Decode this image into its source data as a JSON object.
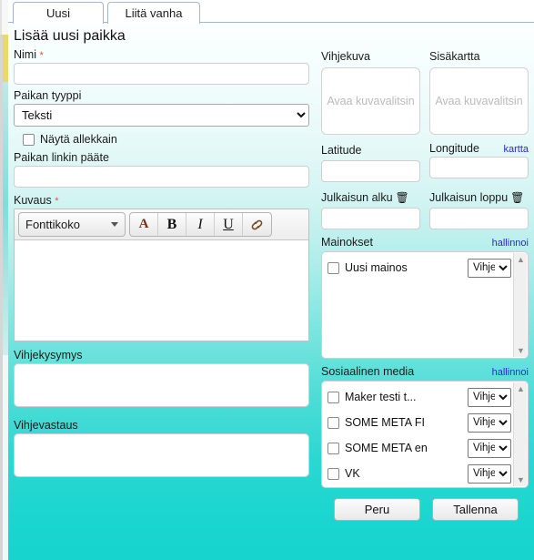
{
  "tabs": [
    {
      "label": "Uusi",
      "active": true
    },
    {
      "label": "Liitä vanha",
      "active": false
    }
  ],
  "page": {
    "title": "Lisää uusi paikka"
  },
  "left": {
    "name": {
      "label": "Nimi",
      "required": "*",
      "value": "",
      "placeholder": ""
    },
    "type": {
      "label": "Paikan tyyppi",
      "selected": "Teksti"
    },
    "show_stacked": {
      "label": "Näytä allekkain",
      "checked": false
    },
    "link_suffix": {
      "label": "Paikan linkin pääte",
      "value": "",
      "placeholder": ""
    },
    "description": {
      "label": "Kuvaus",
      "required": "*",
      "fontsize_label": "Fonttikoko",
      "tools": [
        {
          "name": "font-color-icon",
          "glyph": "A"
        },
        {
          "name": "bold-icon",
          "glyph": "B"
        },
        {
          "name": "italic-icon",
          "glyph": "I"
        },
        {
          "name": "underline-icon",
          "glyph": "U"
        },
        {
          "name": "link-icon",
          "glyph": ""
        }
      ],
      "value": ""
    },
    "hint_question": {
      "label": "Vihjekysymys",
      "value": ""
    },
    "hint_answer": {
      "label": "Vihjevastaus",
      "value": ""
    }
  },
  "right": {
    "hint_image": {
      "label": "Vihjekuva",
      "placeholder": "Avaa kuvavalitsin"
    },
    "indoor_map": {
      "label": "Sisäkartta",
      "placeholder": "Avaa kuvavalitsin"
    },
    "latitude": {
      "label": "Latitude",
      "value": ""
    },
    "longitude": {
      "label": "Longitude",
      "value": ""
    },
    "map_link": "kartta",
    "publish_start": {
      "label": "Julkaisun alku",
      "value": "",
      "trash": "🗑"
    },
    "publish_end": {
      "label": "Julkaisun loppu",
      "value": "",
      "trash": "🗑"
    },
    "ads": {
      "label": "Mainokset",
      "manage_link": "hallinnoi",
      "items": [
        {
          "name": "Uusi mainos",
          "checked": false,
          "select": "Vihje"
        }
      ]
    },
    "social": {
      "label": "Sosiaalinen media",
      "manage_link": "hallinnoi",
      "items": [
        {
          "name": "Maker testi t...",
          "checked": false,
          "select": "Vihje"
        },
        {
          "name": "SOME META FI",
          "checked": false,
          "select": "Vihje"
        },
        {
          "name": "SOME META en",
          "checked": false,
          "select": "Vihje"
        },
        {
          "name": "VK",
          "checked": false,
          "select": "Vihje"
        }
      ]
    },
    "buttons": {
      "cancel": "Peru",
      "save": "Tallenna"
    }
  },
  "colors": {
    "accent_turquoise": "#1bd6d0",
    "link_blue": "#2a2ad0",
    "required_red": "#e2562a",
    "edge_yellow": "#e8d96a"
  }
}
